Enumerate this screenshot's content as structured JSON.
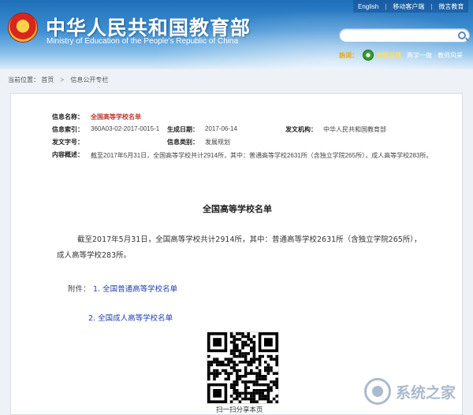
{
  "header": {
    "site_title": "中华人民共和国教育部",
    "site_subtitle": "Ministry of Education of the People's Republic of China",
    "top_links": [
      "English",
      "移动客户端",
      "微言教育"
    ],
    "search": {
      "placeholder": ""
    },
    "hot": {
      "label": "热词：",
      "links": [
        "校园足球",
        "两学一做",
        "教师风采"
      ]
    }
  },
  "breadcrumb": {
    "prefix": "当前位置：",
    "home": "首页",
    "sep": ">",
    "current": "信息公开专栏"
  },
  "meta": {
    "name_label": "信息名称：",
    "name_value": "全国高等学校名单",
    "index_label": "信息索引：",
    "index_value": "360A03-02-2017-0015-1",
    "date_label": "生成日期：",
    "date_value": "2017-06-14",
    "org_label": "发文机构：",
    "org_value": "中华人民共和国教育部",
    "docno_label": "发文字号：",
    "docno_value": "",
    "category_label": "信息类别：",
    "category_value": "发展规划",
    "summary_label": "内容概述：",
    "summary_value": "截至2017年5月31日，全国高等学校共计2914所，其中：普通高等学校2631所（含独立学院265所），成人高等学校283所。"
  },
  "document": {
    "title": "全国高等学校名单",
    "body": "截至2017年5月31日，全国高等学校共计2914所，其中：普通高等学校2631所（含独立学院265所），成人高等学校283所。",
    "attachment_label": "附件：",
    "attachment_1": "1. 全国普通高等学校名单",
    "attachment_2": "2. 全国成人高等学校名单",
    "qr_caption": "扫一扫分享本页"
  },
  "watermark": {
    "text": "系统之家"
  },
  "colors": {
    "header_blue": "#1e6fb8",
    "link_blue": "#1f3fb3",
    "title_red": "#c0392b"
  }
}
